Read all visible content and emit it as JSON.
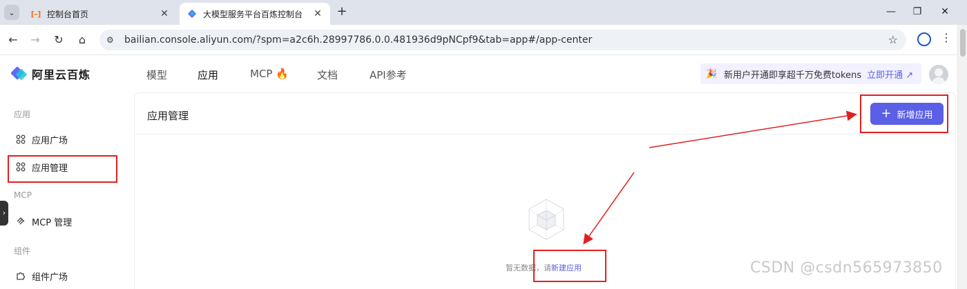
{
  "browser": {
    "tabs": [
      {
        "title": "控制台首页",
        "favicon": "alibaba-cloud-icon",
        "active": false
      },
      {
        "title": "大模型服务平台百炼控制台",
        "favicon": "bailian-icon",
        "active": true
      }
    ],
    "address": "bailian.console.aliyun.com/?spm=a2c6h.28997786.0.0.481936d9pNCpf9&tab=app#/app-center"
  },
  "app": {
    "logo_text": "阿里云百炼",
    "topnav": [
      {
        "label": "模型"
      },
      {
        "label": "应用",
        "active": true
      },
      {
        "label": "MCP"
      },
      {
        "label": "文档"
      },
      {
        "label": "API参考"
      }
    ],
    "promo": {
      "text": "新用户开通即享超千万免费tokens",
      "cta": "立即开通 ↗"
    }
  },
  "sidebar": {
    "groups": [
      {
        "label": "应用",
        "items": [
          {
            "label": "应用广场"
          },
          {
            "label": "应用管理",
            "active": true
          }
        ]
      },
      {
        "label": "MCP",
        "items": [
          {
            "label": "MCP 管理"
          }
        ]
      },
      {
        "label": "组件",
        "items": [
          {
            "label": "组件广场"
          }
        ]
      }
    ]
  },
  "main": {
    "title": "应用管理",
    "create_button": "新增应用",
    "empty_text": "暂无数据，请",
    "empty_link": "新建应用"
  },
  "watermark": "CSDN @csdn565973850",
  "colors": {
    "accent": "#5a5fe6",
    "annotation": "#e02020"
  }
}
